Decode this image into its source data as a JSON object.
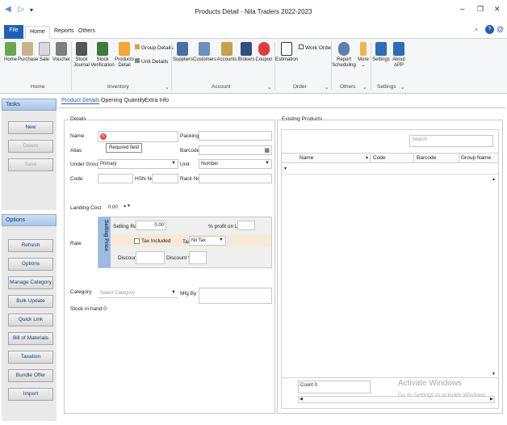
{
  "window": {
    "title": "Products Detail - Nila Traders 2022-2023",
    "minimize_glyph": "–",
    "restore_glyph": "❐",
    "close_glyph": "✕",
    "back_glyph": "◀",
    "forward_glyph": "▷",
    "menu_glyph": "▾"
  },
  "ribbon_tabs": {
    "file": "File",
    "home": "Home",
    "reports": "Reports",
    "others": "Others",
    "chevron_glyph": "^",
    "help_glyph": "?",
    "account_glyph": "@"
  },
  "ribbon": {
    "home_buttons": [
      "Home",
      "Purchase",
      "Sale",
      "Voucher"
    ],
    "inventory_buttons": [
      "Stock Journal",
      "Stock Verification",
      "Products Detail"
    ],
    "group_details": "Group Details",
    "unit_details": "Unit Details",
    "account_buttons": [
      "Suppliers",
      "Customers",
      "Accounts",
      "Brokers",
      "Coupon"
    ],
    "estimation": "Estimation",
    "work_order": "Work Order",
    "report_scheduling": "Report Scheduling",
    "more": "More",
    "settings": "Settings",
    "about_app": "About APP",
    "groups": {
      "home": "Home",
      "inventory": "Inventory",
      "account": "Account",
      "order": "Order",
      "others": "Others",
      "settings": "Settings"
    },
    "expander_glyph": "⌄"
  },
  "tasks": {
    "header": "Tasks",
    "new": "New",
    "delete": "Delete",
    "save": "Save"
  },
  "options": {
    "header": "Options",
    "items": [
      "Refresh",
      "Options",
      "Manage Category",
      "Bulk Update",
      "Quick Link",
      "Bill of Materials",
      "Taxation",
      "Bundle Offer",
      "Import"
    ]
  },
  "subtabs": [
    "Product Details",
    "Opening Quantity",
    "Extra Info"
  ],
  "details": {
    "legend": "Details",
    "name_label": "Name",
    "required_tooltip": "Required field",
    "packing_label": "Packing",
    "alias_label": "Alias",
    "barcode_label": "Barcode",
    "under_group_label": "Under Group",
    "under_group_value": "Primary",
    "unit_label": "Unit",
    "unit_value": "Number",
    "code_label": "Code",
    "hsn_label": "HSN No",
    "rack_label": "Rack No",
    "landing_cost_label": "Landing Cost",
    "landing_cost_value": "0.00",
    "rate_label": "Rate",
    "selling_price_caption": "Selling Price",
    "selling_rate_label": "Selling Rate",
    "selling_rate_value": "0.00",
    "profit_label": "% profit on LC",
    "tax_included_label": "Tax Included",
    "tax_label": "Tax",
    "tax_value": "Nil Tax",
    "discount_label": "Discount",
    "discount_pct_label": "Discount %",
    "category_label": "Category",
    "category_placeholder": "Select Category",
    "mfg_label": "Mfg By",
    "stock_label": "Stock in hand",
    "stock_value": "0"
  },
  "existing": {
    "legend": "Existing Products",
    "search_placeholder": "Search",
    "columns": [
      "Name",
      "Code",
      "Barcode",
      "Group Name"
    ],
    "count": "Count 0"
  },
  "watermark": {
    "line1": "Activate Windows",
    "line2": "Go to Settings to activate Windows."
  },
  "colors": {
    "file_tab": "#1f5fb8",
    "panel_header": "#a8c4e4",
    "selling_price_band": "#9bbbe0",
    "rate_highlight": "#f6e9d6"
  }
}
